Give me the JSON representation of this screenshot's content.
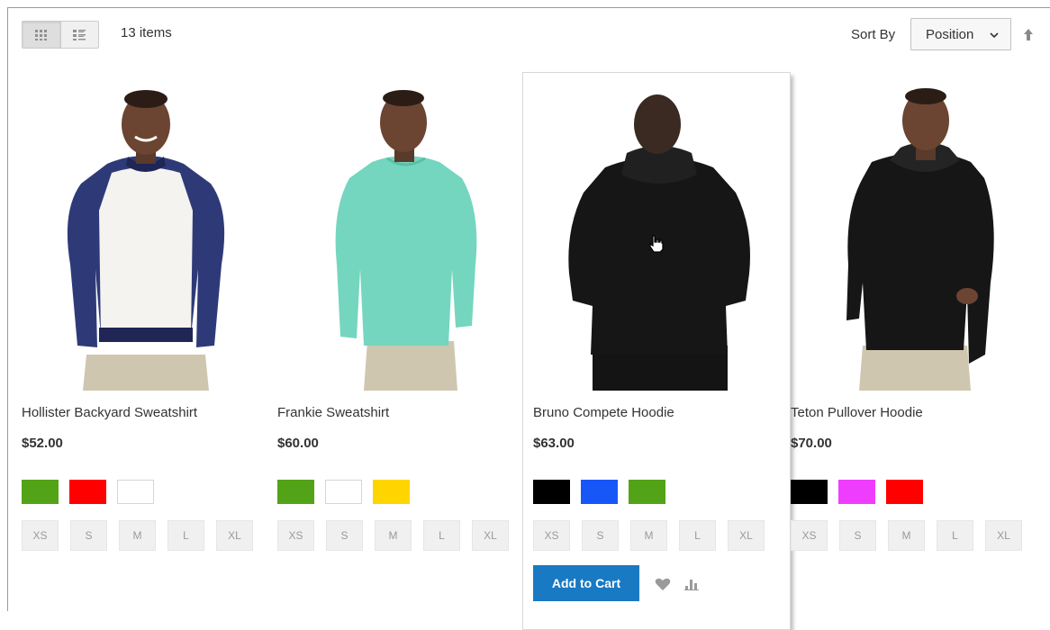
{
  "toolbar": {
    "item_count": "13 items",
    "sort_label": "Sort By",
    "sort_value": "Position",
    "view_modes": [
      {
        "name": "grid-view-icon",
        "active": true
      },
      {
        "name": "list-view-icon",
        "active": false
      }
    ]
  },
  "products": [
    {
      "name": "Hollister Backyard Sweatshirt",
      "price": "$52.00",
      "colors": [
        "#53a318",
        "#ff0000",
        "#ffffff"
      ],
      "sizes": [
        "XS",
        "S",
        "M",
        "L",
        "XL"
      ]
    },
    {
      "name": "Frankie Sweatshirt",
      "price": "$60.00",
      "colors": [
        "#53a318",
        "#ffffff",
        "#ffd500"
      ],
      "sizes": [
        "XS",
        "S",
        "M",
        "L",
        "XL"
      ]
    },
    {
      "name": "Bruno Compete Hoodie",
      "price": "$63.00",
      "colors": [
        "#000000",
        "#1857f7",
        "#53a318"
      ],
      "sizes": [
        "XS",
        "S",
        "M",
        "L",
        "XL"
      ],
      "add_to_cart": "Add to Cart"
    },
    {
      "name": "Teton Pullover Hoodie",
      "price": "$70.00",
      "colors": [
        "#000000",
        "#ef3dff",
        "#ff0000"
      ],
      "sizes": [
        "XS",
        "S",
        "M",
        "L",
        "XL"
      ]
    }
  ]
}
